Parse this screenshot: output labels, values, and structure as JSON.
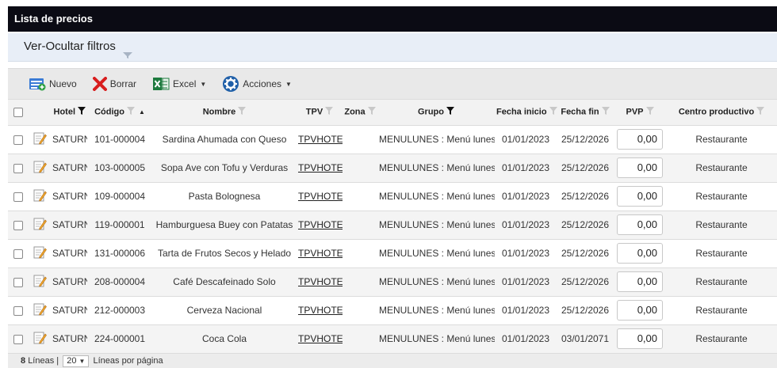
{
  "window": {
    "title": "Lista de precios"
  },
  "filters": {
    "label": "Ver-Ocultar filtros"
  },
  "toolbar": {
    "new_label": "Nuevo",
    "delete_label": "Borrar",
    "excel_label": "Excel",
    "actions_label": "Acciones"
  },
  "table": {
    "headers": {
      "hotel": "Hotel",
      "codigo": "Código",
      "nombre": "Nombre",
      "tpv": "TPV",
      "zona": "Zona",
      "grupo": "Grupo",
      "fecha_inicio": "Fecha inicio",
      "fecha_fin": "Fecha fin",
      "pvp": "PVP",
      "centro": "Centro productivo"
    },
    "rows": [
      {
        "hotel": "SATURNO",
        "codigo": "101-000004",
        "nombre": "Sardina Ahumada con Queso",
        "tpv": "TPVHOTEL",
        "zona": "",
        "grupo": "MENULUNES : Menú lunes",
        "fecha_inicio": "01/01/2023",
        "fecha_fin": "25/12/2026",
        "pvp": "0,00",
        "centro": "Restaurante"
      },
      {
        "hotel": "SATURNO",
        "codigo": "103-000005",
        "nombre": "Sopa Ave con Tofu y Verduras",
        "tpv": "TPVHOTEL",
        "zona": "",
        "grupo": "MENULUNES : Menú lunes",
        "fecha_inicio": "01/01/2023",
        "fecha_fin": "25/12/2026",
        "pvp": "0,00",
        "centro": "Restaurante"
      },
      {
        "hotel": "SATURNO",
        "codigo": "109-000004",
        "nombre": "Pasta Bolognesa",
        "tpv": "TPVHOTEL",
        "zona": "",
        "grupo": "MENULUNES : Menú lunes",
        "fecha_inicio": "01/01/2023",
        "fecha_fin": "25/12/2026",
        "pvp": "0,00",
        "centro": "Restaurante"
      },
      {
        "hotel": "SATURNO",
        "codigo": "119-000001",
        "nombre": "Hamburguesa Buey con Patatas",
        "tpv": "TPVHOTEL",
        "zona": "",
        "grupo": "MENULUNES : Menú lunes",
        "fecha_inicio": "01/01/2023",
        "fecha_fin": "25/12/2026",
        "pvp": "0,00",
        "centro": "Restaurante"
      },
      {
        "hotel": "SATURNO",
        "codigo": "131-000006",
        "nombre": "Tarta de Frutos Secos y Helado",
        "tpv": "TPVHOTEL",
        "zona": "",
        "grupo": "MENULUNES : Menú lunes",
        "fecha_inicio": "01/01/2023",
        "fecha_fin": "25/12/2026",
        "pvp": "0,00",
        "centro": "Restaurante"
      },
      {
        "hotel": "SATURNO",
        "codigo": "208-000004",
        "nombre": "Café Descafeinado Solo",
        "tpv": "TPVHOTEL",
        "zona": "",
        "grupo": "MENULUNES : Menú lunes",
        "fecha_inicio": "01/01/2023",
        "fecha_fin": "25/12/2026",
        "pvp": "0,00",
        "centro": "Restaurante"
      },
      {
        "hotel": "SATURNO",
        "codigo": "212-000003",
        "nombre": "Cerveza Nacional",
        "tpv": "TPVHOTEL",
        "zona": "",
        "grupo": "MENULUNES : Menú lunes",
        "fecha_inicio": "01/01/2023",
        "fecha_fin": "25/12/2026",
        "pvp": "0,00",
        "centro": "Restaurante"
      },
      {
        "hotel": "SATURNO",
        "codigo": "224-000001",
        "nombre": "Coca Cola",
        "tpv": "TPVHOTEL",
        "zona": "",
        "grupo": "MENULUNES : Menú lunes",
        "fecha_inicio": "01/01/2023",
        "fecha_fin": "03/01/2071",
        "pvp": "0,00",
        "centro": "Restaurante"
      }
    ]
  },
  "footer": {
    "line_count": "8",
    "lines_label": "Líneas |",
    "page_size": "20",
    "per_page_label": "Líneas por página"
  },
  "colors": {
    "titlebar_bg": "#0b0b14",
    "filters_bg": "#e8eef7",
    "toolbar_bg": "#e9e9e9",
    "delete_red": "#d81e1e",
    "excel_green": "#1d7a3e",
    "actions_blue": "#1f5fa8"
  },
  "icons": {
    "new": "new-document-icon",
    "delete": "red-x-icon",
    "excel": "excel-icon",
    "actions": "gear-circle-icon",
    "edit": "edit-pencil-icon",
    "filter": "funnel-icon"
  }
}
